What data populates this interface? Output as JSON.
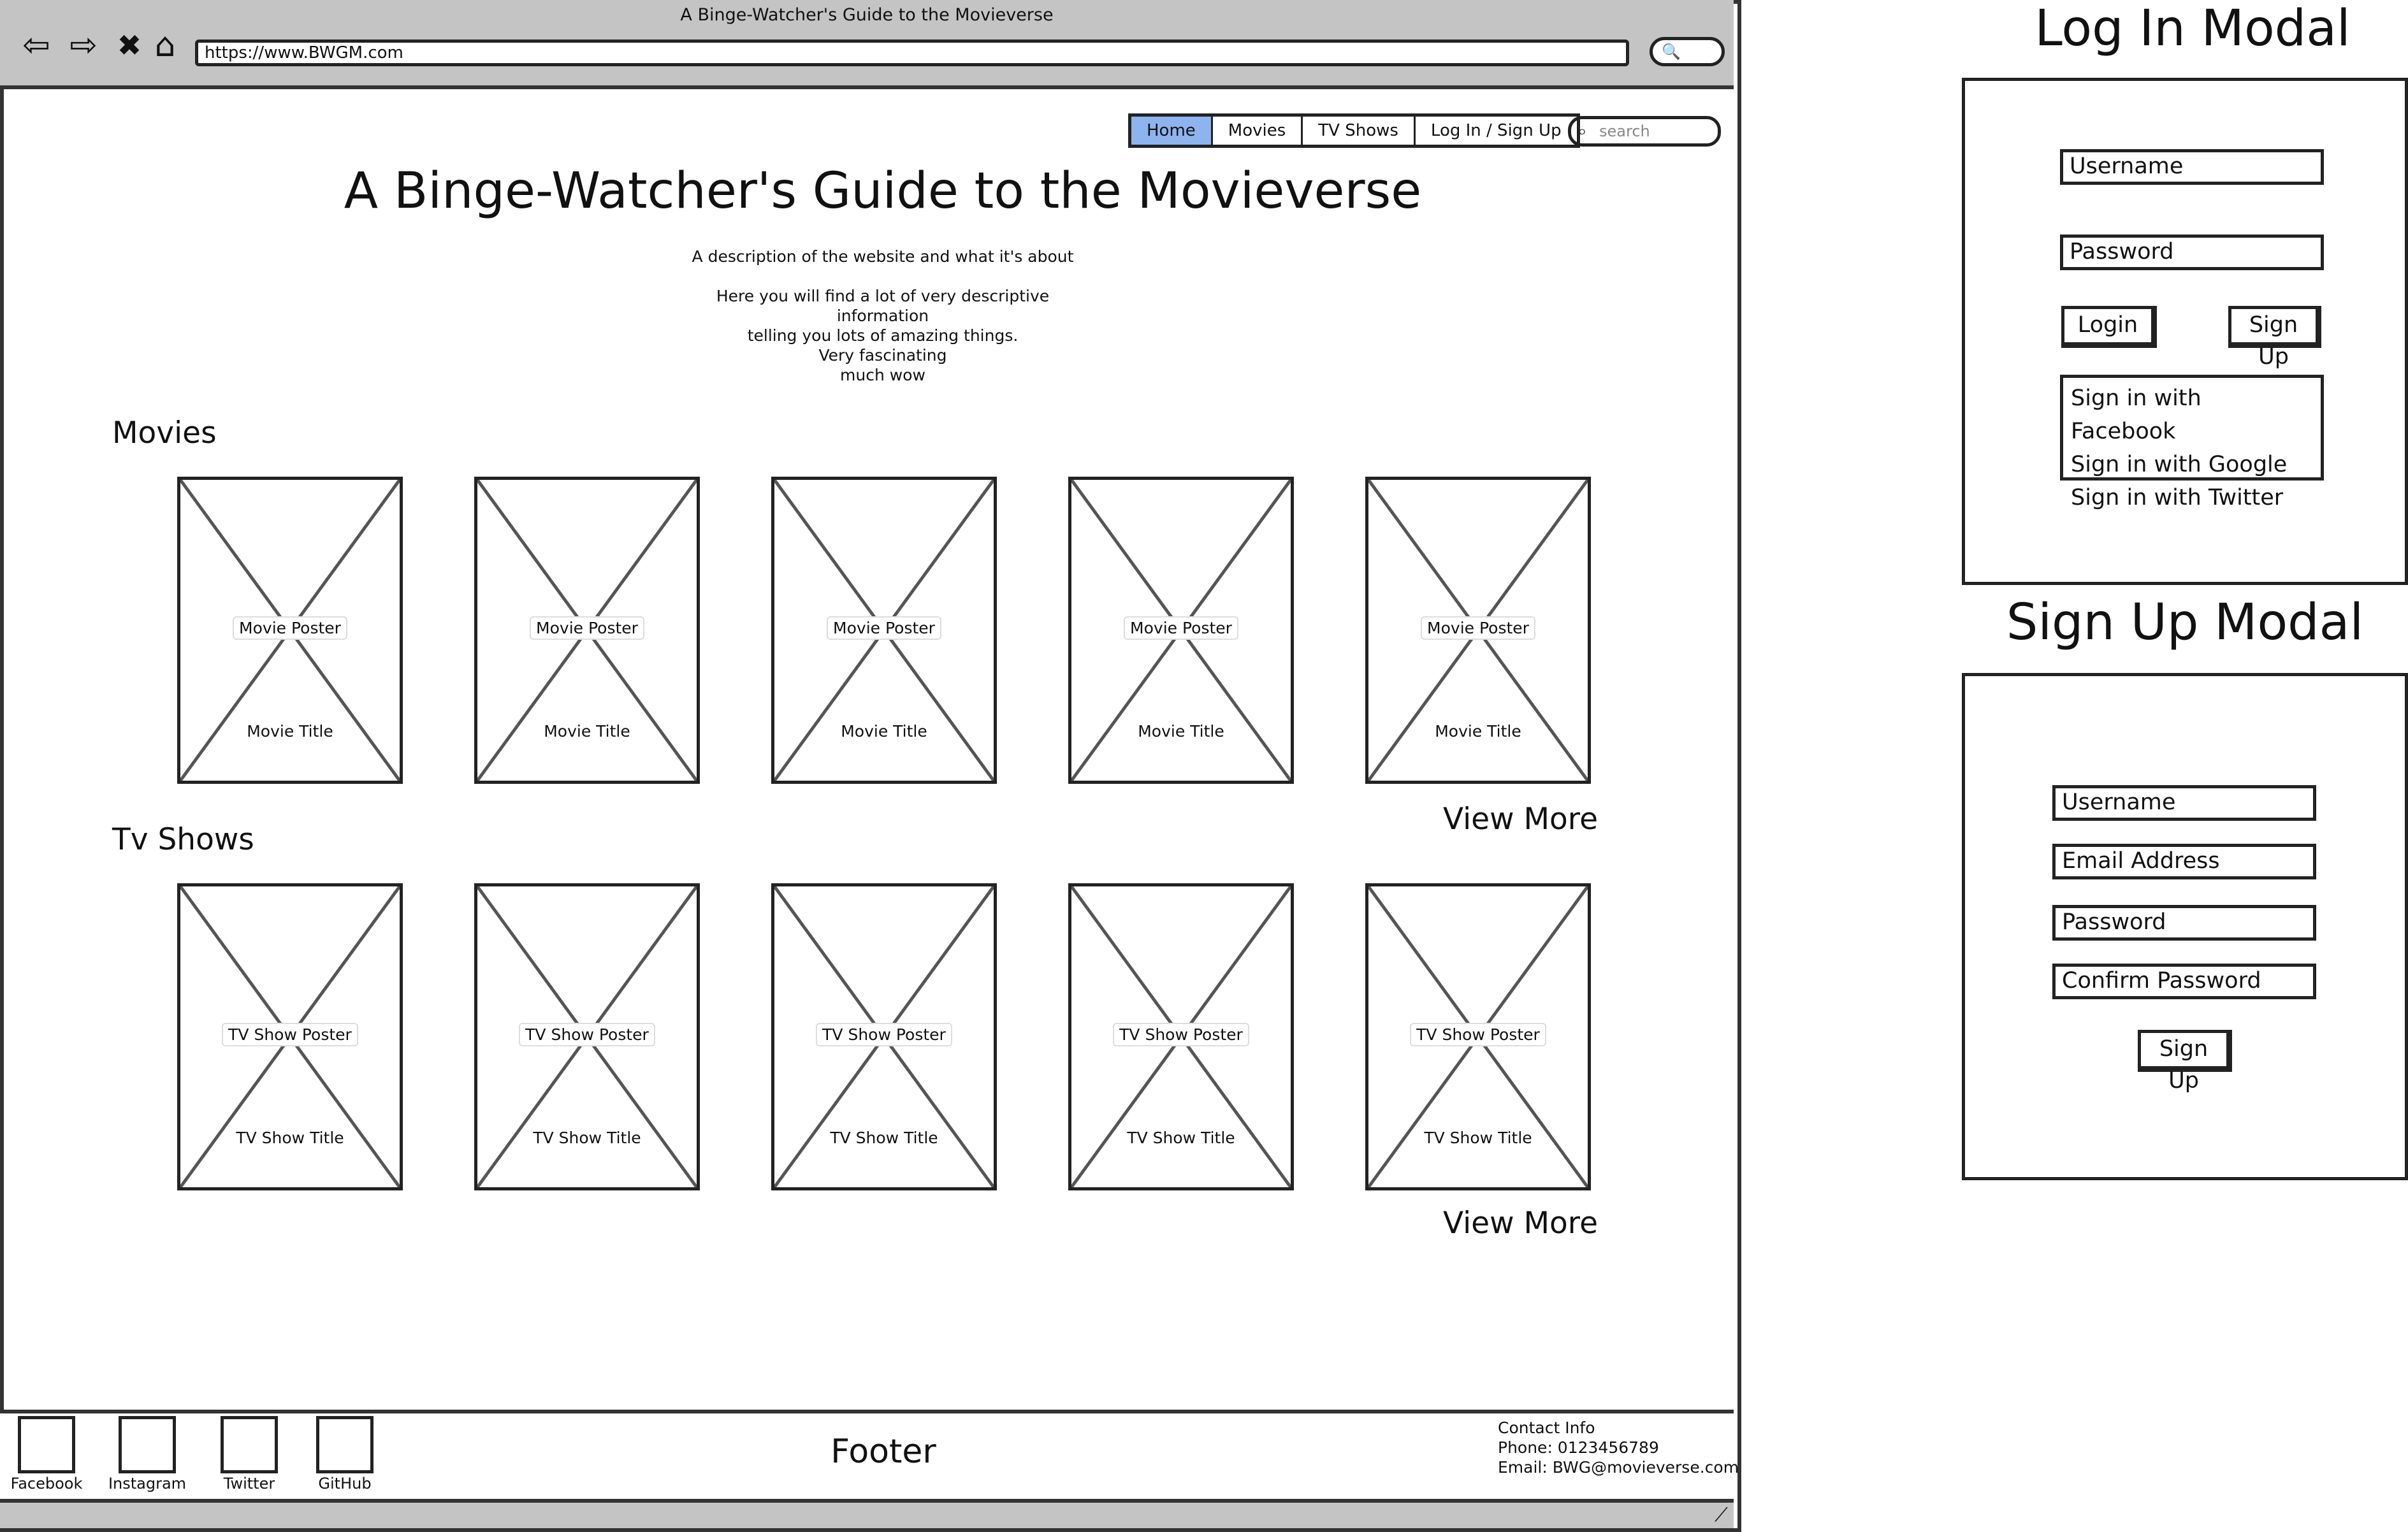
{
  "window": {
    "title": "A Binge-Watcher's Guide to the Movieverse",
    "url": "https://www.BWGM.com"
  },
  "nav": {
    "items": [
      {
        "label": "Home",
        "active": true
      },
      {
        "label": "Movies",
        "active": false
      },
      {
        "label": "TV Shows",
        "active": false
      },
      {
        "label": "Log In / Sign Up",
        "active": false
      }
    ],
    "search_placeholder": "search"
  },
  "hero": {
    "title": "A Binge-Watcher's Guide to the Movieverse",
    "lines": [
      "A description of the website and what it's about",
      "Here  you will find a lot of very descriptive",
      "information",
      "telling you lots of amazing things.",
      "Very fascinating",
      "much wow"
    ]
  },
  "movies": {
    "heading": "Movies",
    "view_more": "View More",
    "cards": [
      {
        "poster": "Movie Poster",
        "title": "Movie Title"
      },
      {
        "poster": "Movie Poster",
        "title": "Movie Title"
      },
      {
        "poster": "Movie Poster",
        "title": "Movie Title"
      },
      {
        "poster": "Movie Poster",
        "title": "Movie Title"
      },
      {
        "poster": "Movie Poster",
        "title": "Movie Title"
      }
    ]
  },
  "tv": {
    "heading": "Tv Shows",
    "view_more": "View More",
    "cards": [
      {
        "poster": "TV Show Poster",
        "title": "TV Show Title"
      },
      {
        "poster": "TV Show Poster",
        "title": "TV Show Title"
      },
      {
        "poster": "TV Show Poster",
        "title": "TV Show Title"
      },
      {
        "poster": "TV Show Poster",
        "title": "TV Show Title"
      },
      {
        "poster": "TV Show Poster",
        "title": "TV Show Title"
      }
    ]
  },
  "footer": {
    "title": "Footer",
    "socials": [
      "Facebook",
      "Instagram",
      "Twitter",
      "GitHub"
    ],
    "contact": {
      "heading": "Contact Info",
      "phone": "Phone: 0123456789",
      "email": "Email: BWG@movieverse.com"
    }
  },
  "login_modal": {
    "heading": "Log In Modal",
    "username": "Username",
    "password": "Password",
    "login_button": "Login",
    "signup_button": "Sign Up",
    "social_options": [
      "Sign in with Facebook",
      "Sign in with Google",
      "Sign in with Twitter"
    ]
  },
  "signup_modal": {
    "heading": "Sign Up Modal",
    "username": "Username",
    "email": "Email Address",
    "password": "Password",
    "confirm_password": "Confirm Password",
    "signup_button": "Sign Up"
  },
  "colors": {
    "active_tab": "#8db4ee",
    "chrome": "#c4c4c4",
    "stroke": "#222222"
  }
}
